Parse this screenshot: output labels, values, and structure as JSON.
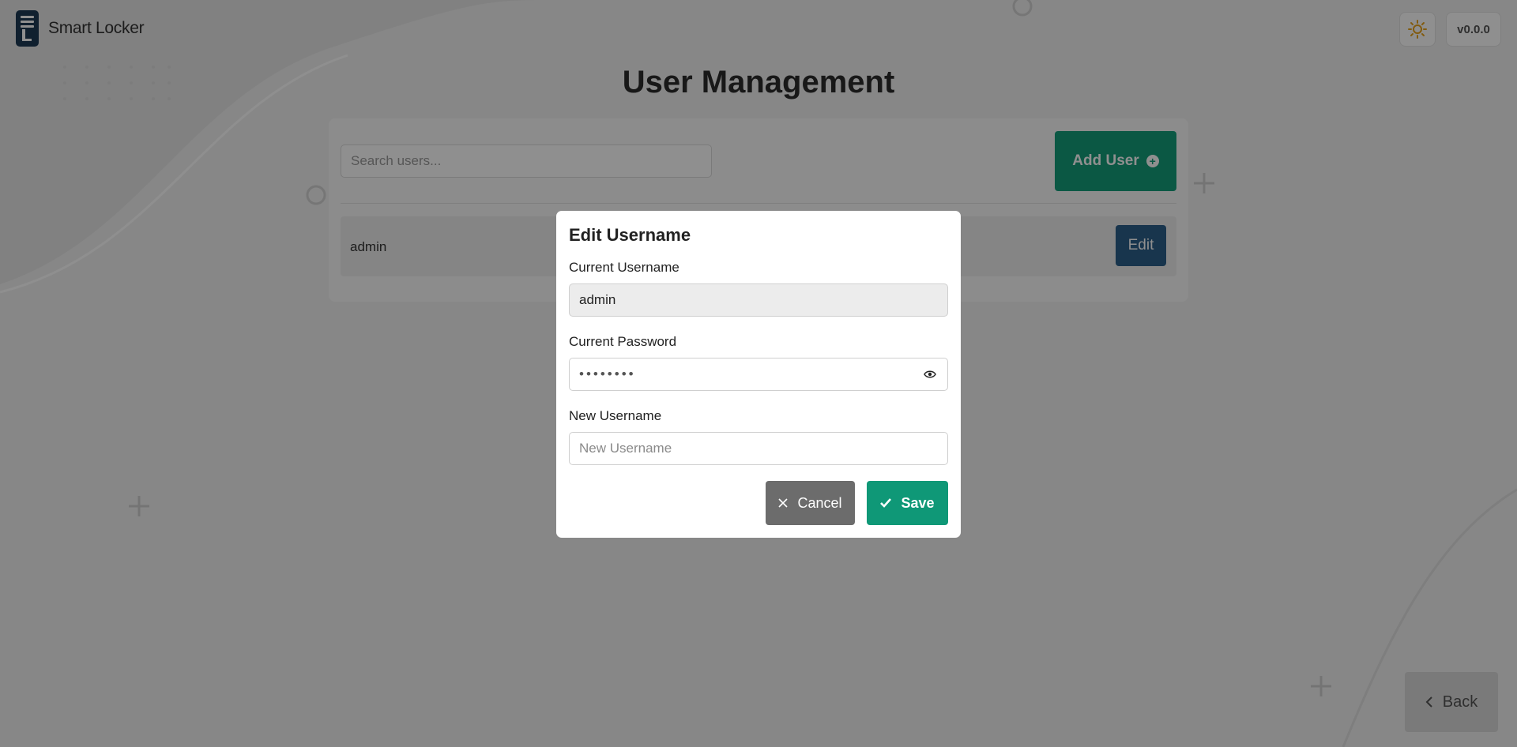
{
  "header": {
    "app_name": "Smart Locker",
    "theme_icon": "sun-icon",
    "version": "v0.0.0"
  },
  "page": {
    "title": "User Management"
  },
  "users_panel": {
    "search_placeholder": "Search users...",
    "add_user_label": "Add User",
    "add_user_icon": "plus-circle-icon",
    "users": [
      {
        "username": "admin",
        "edit_label": "Edit"
      }
    ]
  },
  "back_button": {
    "label": "Back",
    "icon": "chevron-left-icon"
  },
  "edit_username_dialog": {
    "title": "Edit Username",
    "current_username_label": "Current Username",
    "current_username_value": "admin",
    "current_password_label": "Current Password",
    "current_password_value": "••••••••",
    "password_toggle_icon": "eye-icon",
    "new_username_label": "New Username",
    "new_username_placeholder": "New Username",
    "cancel_label": "Cancel",
    "cancel_icon": "close-icon",
    "save_label": "Save",
    "save_icon": "check-icon"
  },
  "colors": {
    "primary_green": "#159e7a",
    "edit_blue": "#2b5f8a",
    "cancel_gray": "#6c6c6c",
    "logo_navy": "#1e3a55"
  }
}
